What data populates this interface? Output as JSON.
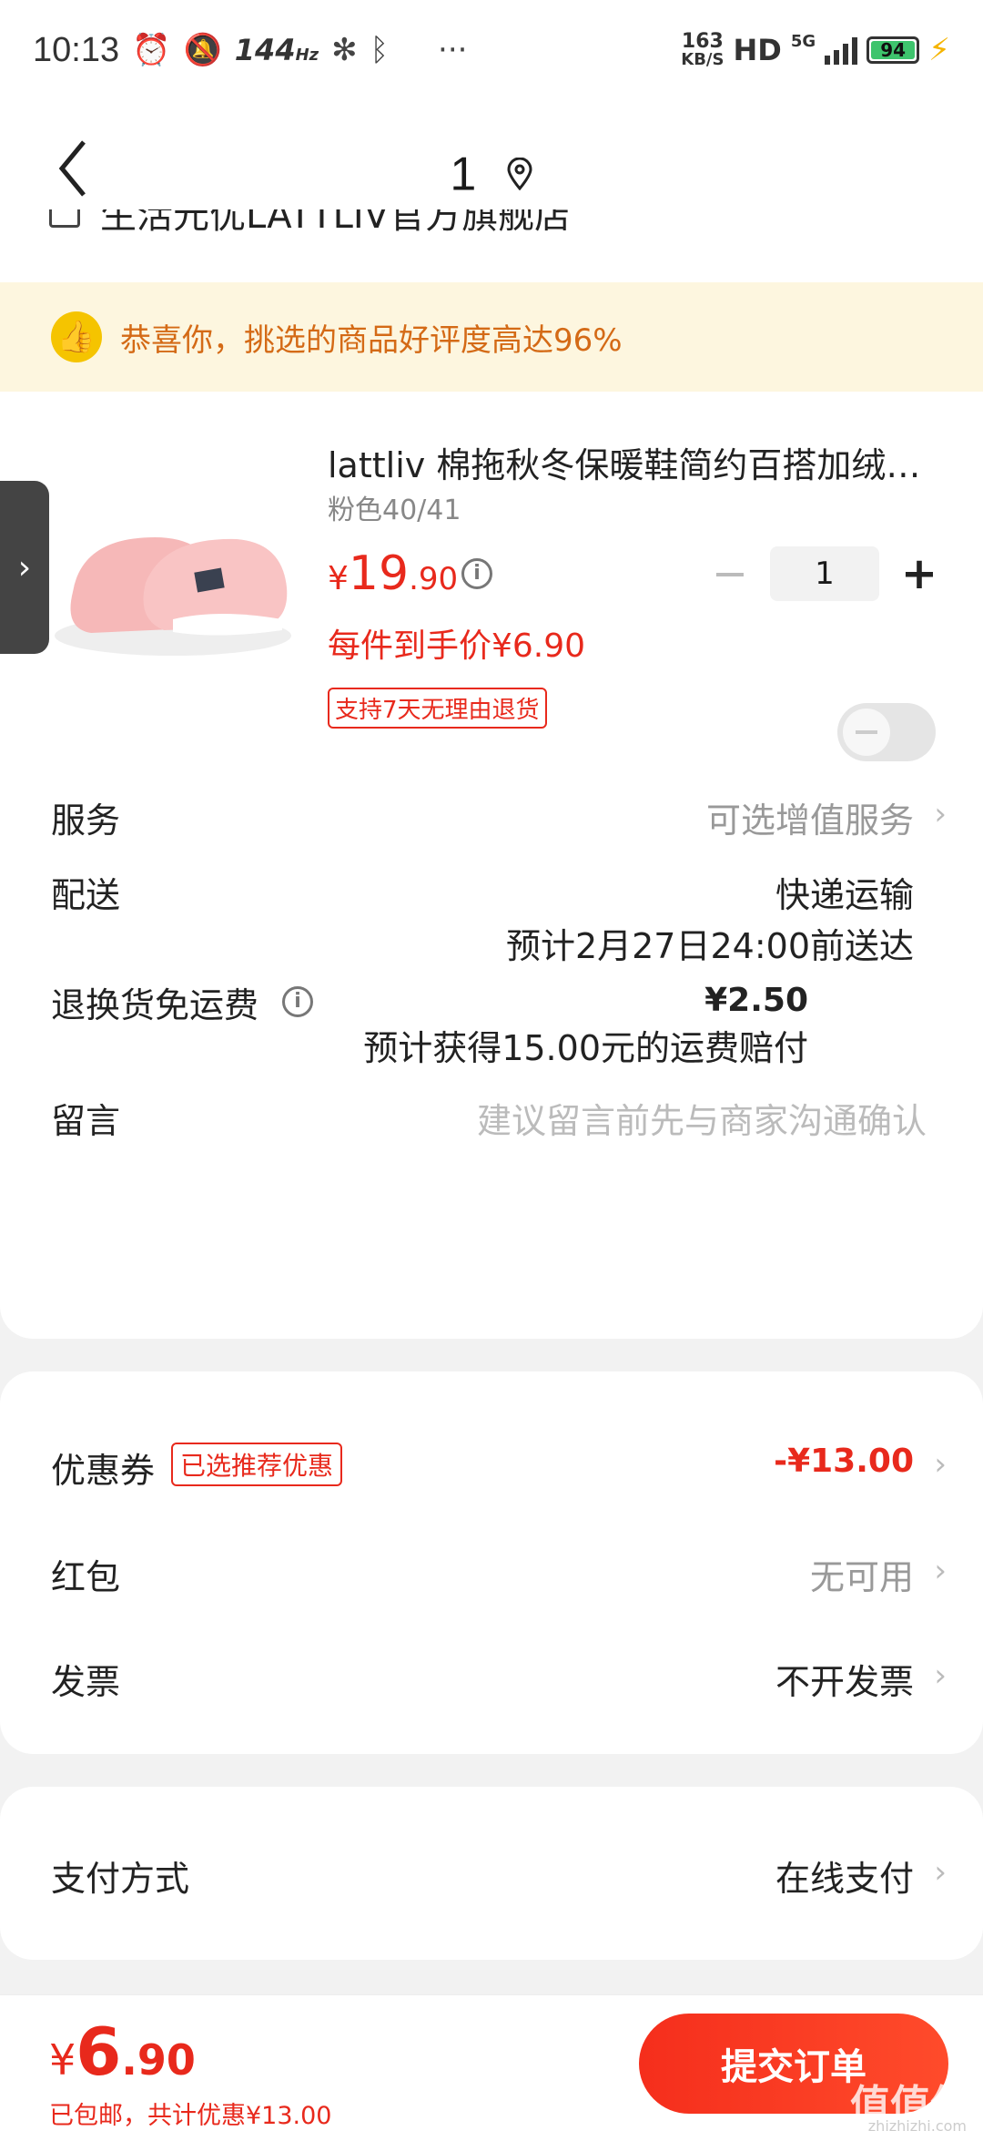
{
  "status_bar": {
    "time": "10:13",
    "refresh_rate": "144",
    "refresh_unit": "Hz",
    "net_speed": "163",
    "net_unit": "KB/S",
    "hd": "HD",
    "network": "5G",
    "battery": "94"
  },
  "nav": {
    "title": "1"
  },
  "shop": {
    "name": "生活元优LATTLIV官方旗舰店"
  },
  "banner": {
    "text": "恭喜你，挑选的商品好评度高达96%"
  },
  "product": {
    "name": "lattliv 棉拖秋冬保暖鞋简约百搭加绒…",
    "spec": "粉色40/41",
    "price_currency": "¥",
    "price_int": "19",
    "price_dec": ".90",
    "each_price": "每件到手价¥6.90",
    "return_policy": "支持7天无理由退货",
    "quantity": "1",
    "minus": "−",
    "plus": "+"
  },
  "service": {
    "label": "服务",
    "value": "可选增值服务"
  },
  "delivery": {
    "label": "配送",
    "method": "快递运输",
    "eta": "预计2月27日24:00前送达"
  },
  "return_shipping": {
    "label": "退换货免运费",
    "price": "¥2.50",
    "note": "预计获得15.00元的运费赔付",
    "enabled": false
  },
  "message": {
    "label": "留言",
    "placeholder": "建议留言前先与商家沟通确认"
  },
  "coupon": {
    "label": "优惠券",
    "tag": "已选推荐优惠",
    "value": "-¥13.00"
  },
  "red_packet": {
    "label": "红包",
    "value": "无可用"
  },
  "invoice": {
    "label": "发票",
    "value": "不开发票"
  },
  "payment": {
    "label": "支付方式",
    "value": "在线支付"
  },
  "footer": {
    "total_currency": "¥",
    "total_int": "6",
    "total_dec": ".90",
    "summary": "已包邮，共计优惠¥13.00",
    "submit_label": "提交订单",
    "watermark": "值值值",
    "watermark_sub": "zhizhizhi.com"
  },
  "colors": {
    "accent": "#e8291c",
    "banner_bg": "#fdf6df",
    "banner_text": "#d46a16"
  }
}
